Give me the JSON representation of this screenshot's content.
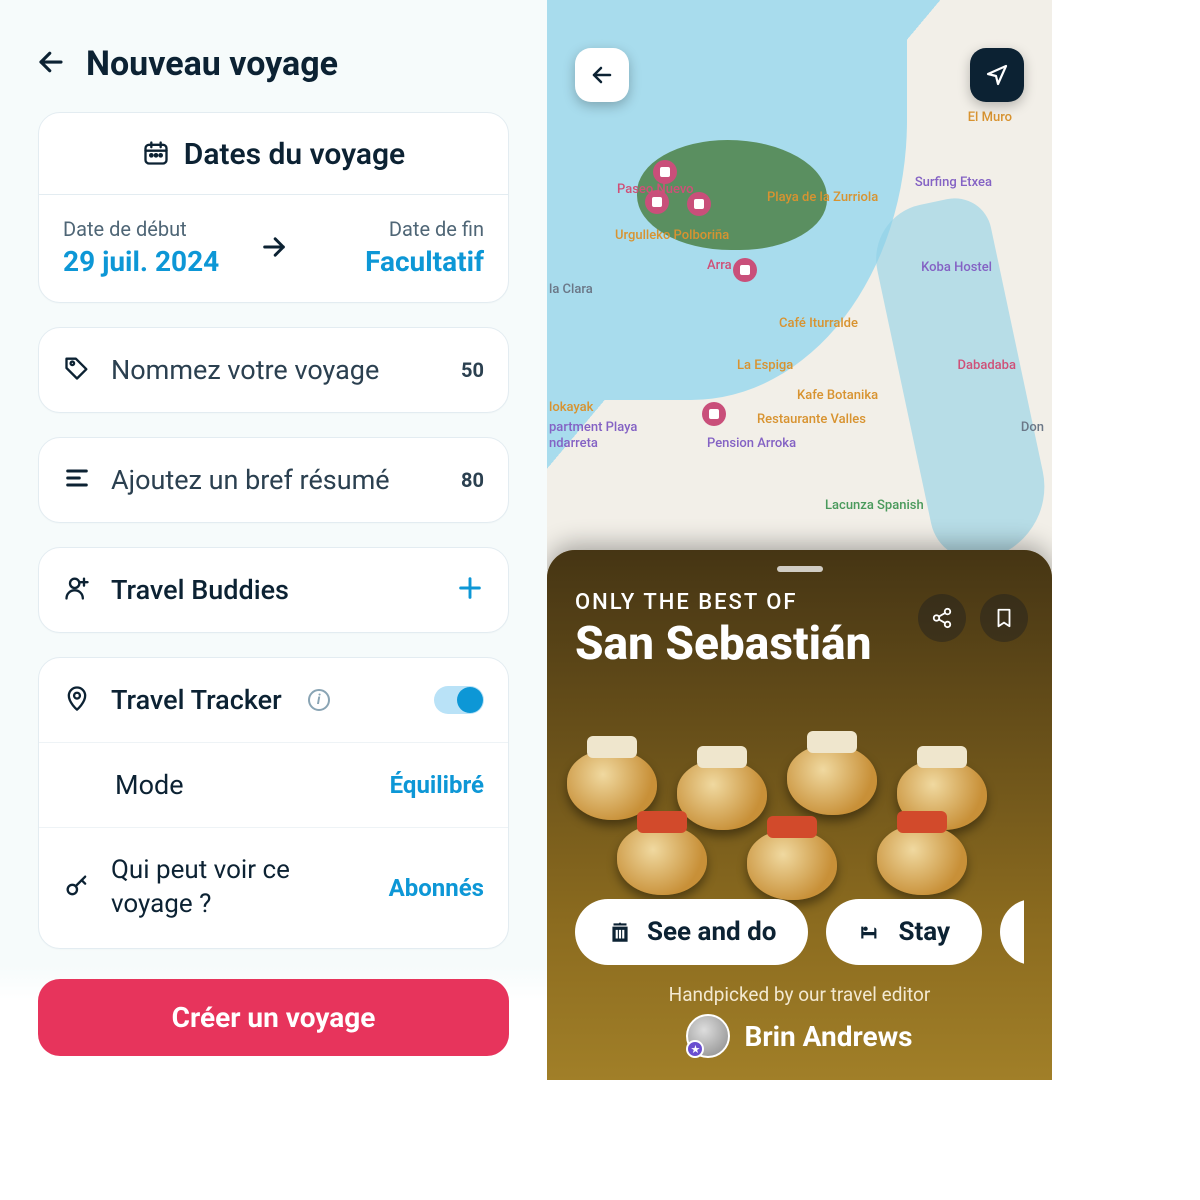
{
  "left": {
    "page_title": "Nouveau voyage",
    "dates": {
      "section_title": "Dates du voyage",
      "start_label": "Date de début",
      "start_value": "29 juil. 2024",
      "end_label": "Date de fin",
      "end_value": "Facultatif"
    },
    "name_field": {
      "placeholder": "Nommez votre voyage",
      "limit": "50"
    },
    "summary_field": {
      "placeholder": "Ajoutez un bref résumé",
      "limit": "80"
    },
    "buddies": {
      "label": "Travel Buddies"
    },
    "tracker": {
      "title": "Travel Tracker",
      "enabled": true,
      "mode_label": "Mode",
      "mode_value": "Équilibré",
      "visibility_label": "Qui peut voir ce voyage ?",
      "visibility_value": "Abonnés"
    },
    "create_button": "Créer un voyage"
  },
  "right": {
    "map_labels": [
      "El Muro",
      "Surfing Etxea",
      "Playa de la Zurriola",
      "Koba Hostel",
      "Paseo Nuevo",
      "Urgulleko Polboriña",
      "Arra",
      "la Clara",
      "Café Iturralde",
      "La Espiga",
      "Dabadaba",
      "Kafe Botanika",
      "lokayak",
      "partment Playa",
      "ndarreta",
      "Restaurante Valles",
      "Pension Arroka",
      "Lacunza Spanish",
      "Don"
    ],
    "sheet": {
      "eyebrow": "ONLY THE BEST OF",
      "destination": "San Sebastián",
      "pills": [
        "See and do",
        "Stay"
      ],
      "handpicked": "Handpicked by our travel editor",
      "editor_name": "Brin  Andrews"
    }
  }
}
